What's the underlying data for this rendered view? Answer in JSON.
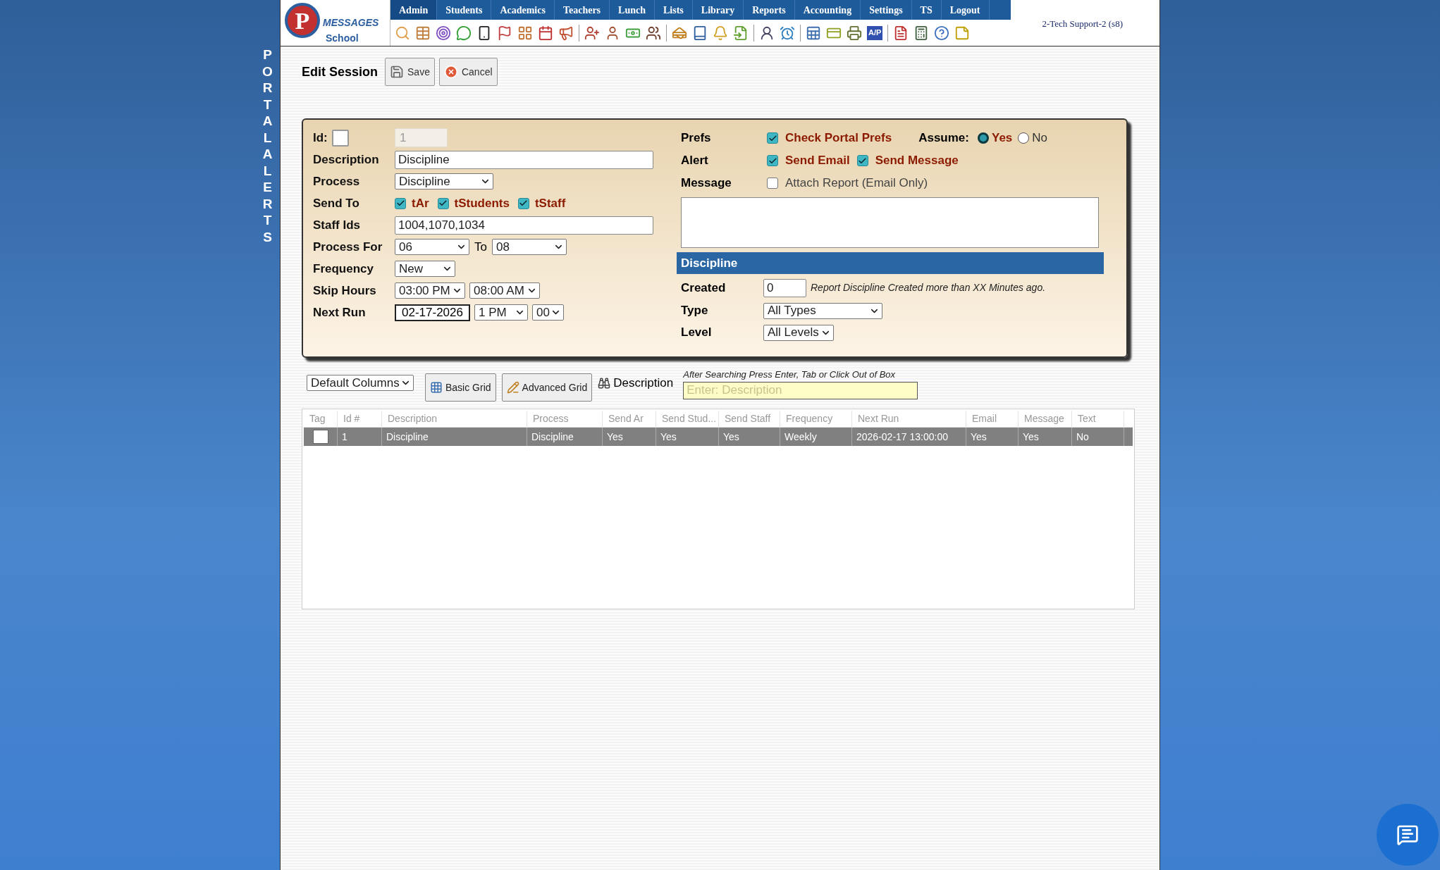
{
  "side_title": "PORTAL ALERTS",
  "header": {
    "logo_letter": "P",
    "logo_text": "MESSAGES",
    "logo_sub": "School",
    "nav": [
      {
        "label": "Admin",
        "selected": true
      },
      {
        "label": "Students",
        "selected": false
      },
      {
        "label": "Academics",
        "selected": false
      },
      {
        "label": "Teachers",
        "selected": false
      },
      {
        "label": "Lunch",
        "selected": false
      },
      {
        "label": "Lists",
        "selected": false
      },
      {
        "label": "Library",
        "selected": false
      },
      {
        "label": "Reports",
        "selected": false
      },
      {
        "label": "Accounting",
        "selected": false
      },
      {
        "label": "Settings",
        "selected": false
      },
      {
        "label": "TS",
        "selected": false
      },
      {
        "label": "Logout",
        "selected": false
      }
    ],
    "ap_label": "A/P",
    "user": "2-Tech Support-2 (s8)"
  },
  "page_title": "Edit Session",
  "buttons": [
    {
      "kind": "save",
      "label": "Save"
    },
    {
      "kind": "cancel",
      "label": "Cancel"
    }
  ],
  "form_left": [
    {
      "kind": "id",
      "label": "Id:",
      "checked": false,
      "value": "1"
    },
    {
      "kind": "text",
      "label": "Description",
      "value": "Discipline"
    },
    {
      "kind": "select",
      "label": "Process",
      "value": "Discipline"
    },
    {
      "kind": "checks",
      "label": "Send To",
      "options": [
        {
          "label": "tAr",
          "checked": true
        },
        {
          "label": "tStudents",
          "checked": true
        },
        {
          "label": "tStaff",
          "checked": true
        }
      ]
    },
    {
      "kind": "text",
      "label": "Staff Ids",
      "value": "1004,1070,1034"
    },
    {
      "kind": "range",
      "label": "Process For",
      "from": "06",
      "joiner": "To",
      "to": "08"
    },
    {
      "kind": "select",
      "label": "Frequency",
      "value": "New"
    },
    {
      "kind": "selects",
      "label": "Skip Hours",
      "values": [
        "03:00 PM",
        "08:00 AM"
      ]
    },
    {
      "kind": "date",
      "label": "Next Run",
      "date": "02-17-2026",
      "values": [
        "1 PM",
        "00"
      ]
    }
  ],
  "prefs": {
    "label": "Prefs",
    "check": {
      "label": "Check Portal Prefs",
      "checked": true
    },
    "assume_label": "Assume:",
    "radios": [
      {
        "label": "Yes",
        "selected": true
      },
      {
        "label": "No",
        "selected": false
      }
    ]
  },
  "alert": {
    "label": "Alert",
    "checks": [
      {
        "label": "Send Email",
        "checked": true
      },
      {
        "label": "Send Message",
        "checked": true
      }
    ]
  },
  "message": {
    "label": "Message",
    "check": {
      "label": "Attach Report (Email Only)",
      "checked": false
    }
  },
  "section_title": "Discipline",
  "created": {
    "label": "Created",
    "value": "0",
    "note": "Report Discipline Created more than XX Minutes ago."
  },
  "type": {
    "label": "Type",
    "value": "All Types"
  },
  "level": {
    "label": "Level",
    "value": "All Levels"
  },
  "grid_tools": {
    "columns_select": "Default Columns",
    "buttons": [
      {
        "kind": "basic",
        "label": "Basic Grid"
      },
      {
        "kind": "advanced",
        "label": "Advanced Grid"
      }
    ],
    "search_label": "Description",
    "hint": "After Searching Press Enter, Tab or Click Out of Box",
    "placeholder": "Enter: Description"
  },
  "table": {
    "columns": [
      "Tag",
      "Id #",
      "Description",
      "Process",
      "Send Ar",
      "Send Stud...",
      "Send Staff",
      "Frequency",
      "Next Run",
      "Email",
      "Message",
      "Text"
    ],
    "rows": [
      {
        "selected": true,
        "tag_checked": false,
        "cells": [
          "",
          "1",
          "Discipline",
          "Discipline",
          "Yes",
          "Yes",
          "Yes",
          "Weekly",
          "2026-02-17 13:00:00",
          "Yes",
          "Yes",
          "No"
        ]
      }
    ]
  }
}
